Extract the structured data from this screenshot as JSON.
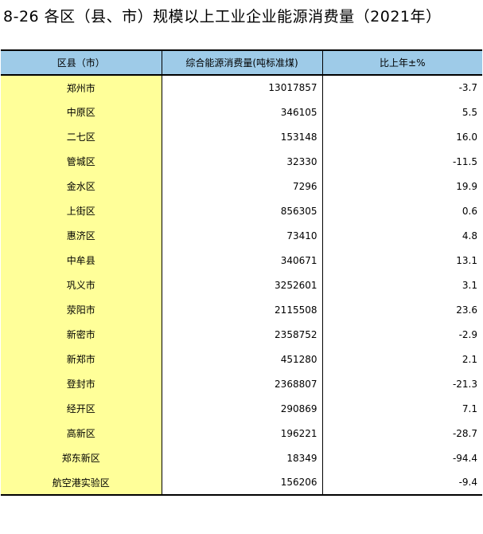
{
  "title": "8-26 各区（县、市）规模以上工业企业能源消费量（2021年）",
  "table": {
    "headers": [
      "区县（市）",
      "综合能源消费量(吨标准煤)",
      "比上年±%"
    ],
    "rows": [
      [
        "郑州市",
        "13017857",
        "-3.7"
      ],
      [
        "中原区",
        "346105",
        "5.5"
      ],
      [
        "二七区",
        "153148",
        "16.0"
      ],
      [
        "管城区",
        "32330",
        "-11.5"
      ],
      [
        "金水区",
        "7296",
        "19.9"
      ],
      [
        "上街区",
        "856305",
        "0.6"
      ],
      [
        "惠济区",
        "73410",
        "4.8"
      ],
      [
        "中牟县",
        "340671",
        "13.1"
      ],
      [
        "巩义市",
        "3252601",
        "3.1"
      ],
      [
        "荥阳市",
        "2115508",
        "23.6"
      ],
      [
        "新密市",
        "2358752",
        "-2.9"
      ],
      [
        "新郑市",
        "451280",
        "2.1"
      ],
      [
        "登封市",
        "2368807",
        "-21.3"
      ],
      [
        "经开区",
        "290869",
        "7.1"
      ],
      [
        "高新区",
        "196221",
        "-28.7"
      ],
      [
        "郑东新区",
        "18349",
        "-94.4"
      ],
      [
        "航空港实验区",
        "156206",
        "-9.4"
      ]
    ]
  },
  "colors": {
    "header_bg": "#9ecbe8",
    "name_col_bg": "#ffff99"
  }
}
